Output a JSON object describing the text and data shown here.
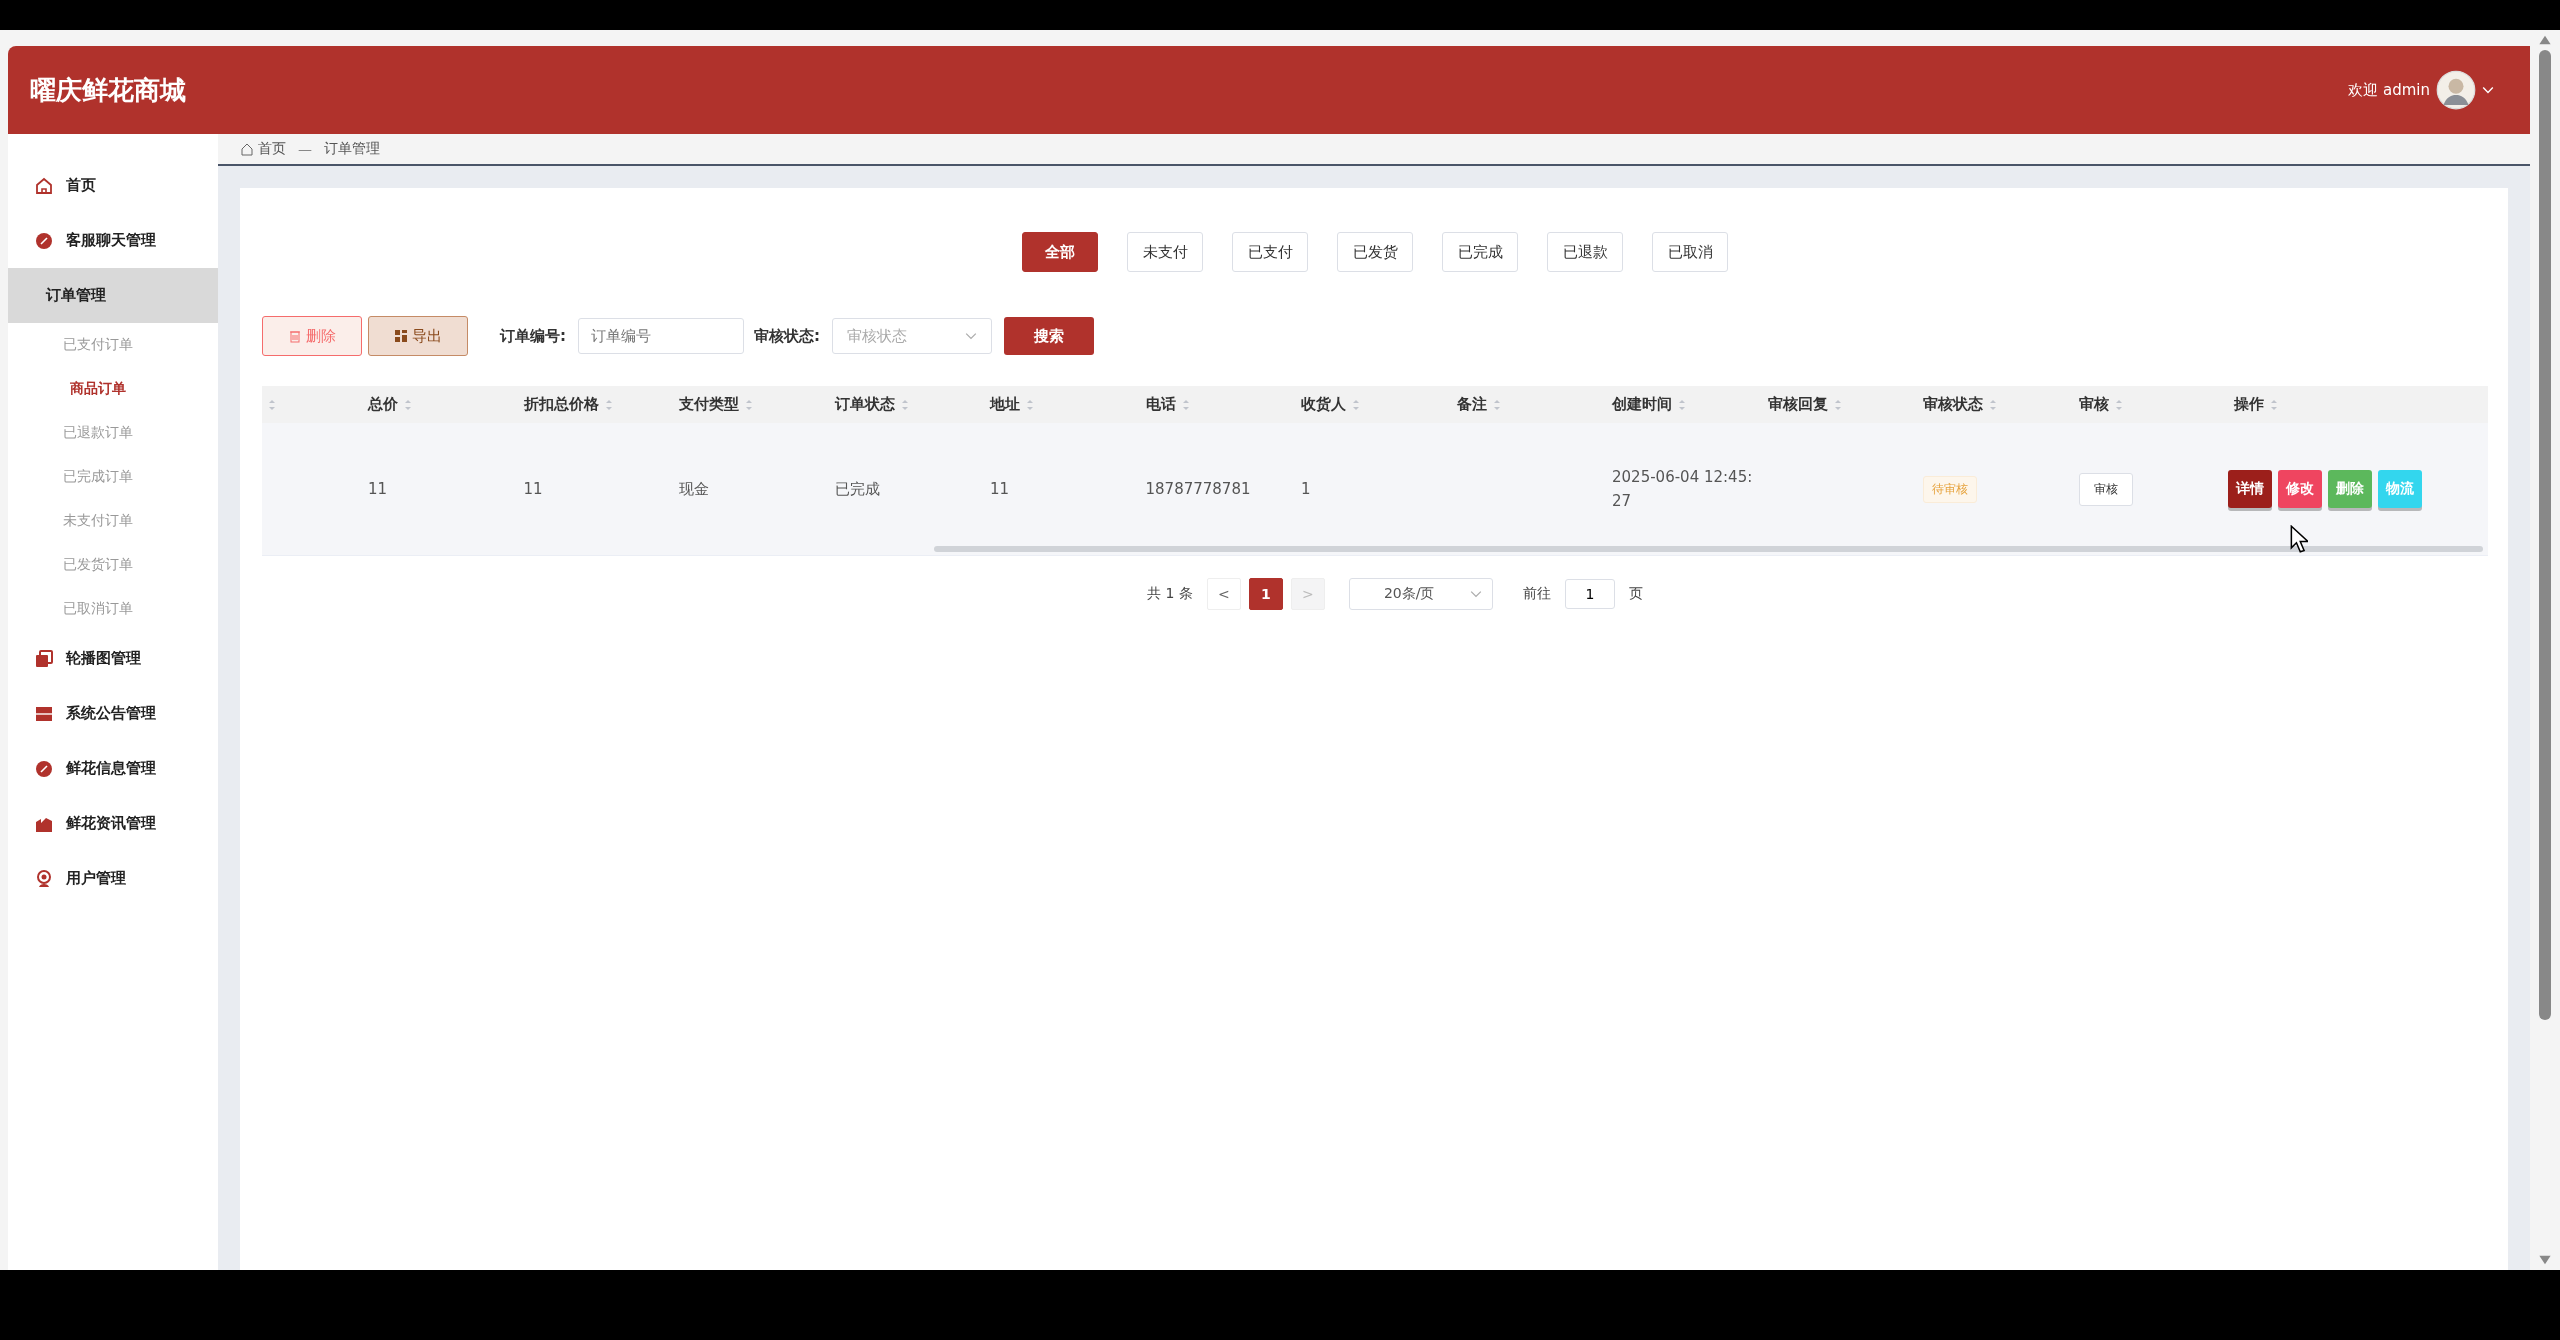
{
  "header": {
    "title": "曜庆鲜花商城",
    "welcome": "欢迎 admin"
  },
  "sidebar": {
    "items": [
      {
        "label": "首页",
        "kind": "home",
        "expanded": false,
        "selected": false
      },
      {
        "label": "客服聊天管理",
        "kind": "dial",
        "expanded": false,
        "selected": false
      },
      {
        "label": "订单管理",
        "kind": "group",
        "expanded": true,
        "selected": false,
        "children": [
          {
            "label": "已支付订单",
            "selected": false
          },
          {
            "label": "商品订单",
            "selected": true
          },
          {
            "label": "已退款订单",
            "selected": false
          },
          {
            "label": "已完成订单",
            "selected": false
          },
          {
            "label": "未支付订单",
            "selected": false
          },
          {
            "label": "已发货订单",
            "selected": false
          },
          {
            "label": "已取消订单",
            "selected": false
          }
        ]
      },
      {
        "label": "轮播图管理",
        "kind": "copy",
        "expanded": false,
        "selected": false
      },
      {
        "label": "系统公告管理",
        "kind": "board",
        "expanded": false,
        "selected": false
      },
      {
        "label": "鲜花信息管理",
        "kind": "dial",
        "expanded": false,
        "selected": false
      },
      {
        "label": "鲜花资讯管理",
        "kind": "chart",
        "expanded": false,
        "selected": false
      },
      {
        "label": "用户管理",
        "kind": "user",
        "expanded": false,
        "selected": false
      }
    ]
  },
  "breadcrumb": [
    "首页",
    "—",
    "订单管理"
  ],
  "tabs": [
    {
      "label": "全部",
      "selected": true
    },
    {
      "label": "未支付",
      "selected": false
    },
    {
      "label": "已支付",
      "selected": false
    },
    {
      "label": "已发货",
      "selected": false
    },
    {
      "label": "已完成",
      "selected": false
    },
    {
      "label": "已退款",
      "selected": false
    },
    {
      "label": "已取消",
      "selected": false
    }
  ],
  "toolbar": {
    "buttons": [
      {
        "label": "删除",
        "kind": "delete"
      },
      {
        "label": "导出",
        "kind": "export"
      }
    ],
    "filters": [
      {
        "label": "订单编号:",
        "kind": "text",
        "placeholder": "订单编号"
      },
      {
        "label": "审核状态:",
        "kind": "select",
        "placeholder": "审核状态"
      }
    ],
    "search": "搜索"
  },
  "table": {
    "columns": [
      "",
      "总价",
      "折扣总价格",
      "支付类型",
      "订单状态",
      "地址",
      "电话",
      "收货人",
      "备注",
      "创建时间",
      "审核回复",
      "审核状态",
      "审核",
      "操作"
    ],
    "rows": [
      {
        "cells": [
          "",
          "11",
          "11",
          "现金",
          "已完成",
          "11",
          "18787778781",
          "1",
          "",
          "2025-06-04 12:45:\n27",
          ""
        ],
        "audit_status": "待审核",
        "audit_button": "审核",
        "actions": [
          {
            "label": "详情",
            "color": "#9c1f1b"
          },
          {
            "label": "修改",
            "color": "#ef4560"
          },
          {
            "label": "删除",
            "color": "#5cb85c"
          },
          {
            "label": "物流",
            "color": "#33d6ee"
          }
        ]
      }
    ]
  },
  "pagination": {
    "total": "共 1 条",
    "prev": "<",
    "pages": [
      {
        "label": "1",
        "selected": true
      }
    ],
    "next": ">",
    "page_size": "20条/页",
    "goto": "前往",
    "goto_value": "1",
    "page_unit": "页"
  }
}
